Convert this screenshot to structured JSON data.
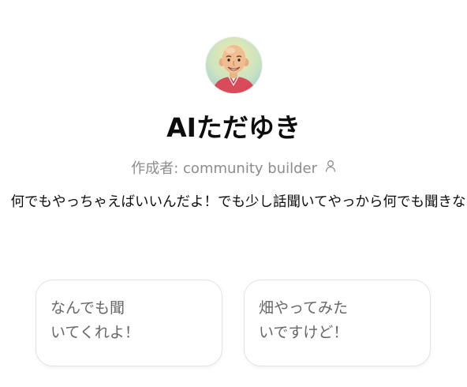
{
  "profile": {
    "title": "AIただゆき",
    "creator": "作成者: community builder",
    "description": "何でもやっちゃえばいいんだよ！でも少し話聞いてやっから何でも聞きな"
  },
  "icons": {
    "avatar": "bald-man-avatar-illustration",
    "creator": "person-icon"
  },
  "starters": [
    {
      "line1": "なんでも聞",
      "line2": "いてくれよ！"
    },
    {
      "line1": "畑やってみた",
      "line2": "いですけど！"
    }
  ],
  "colors": {
    "text_primary": "#0d0d0d",
    "text_muted": "#8c8c8c",
    "card_text": "#676767",
    "card_border": "#e3e3e3",
    "avatar_jacket": "#d94a5a"
  }
}
